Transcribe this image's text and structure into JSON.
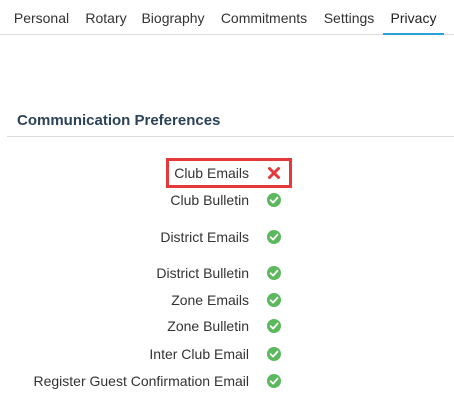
{
  "tabs": [
    {
      "label": "Personal",
      "active": false
    },
    {
      "label": "Rotary",
      "active": false
    },
    {
      "label": "Biography",
      "active": false
    },
    {
      "label": "Commitments",
      "active": false
    },
    {
      "label": "Settings",
      "active": false
    },
    {
      "label": "Privacy",
      "active": true
    }
  ],
  "section": {
    "title": "Communication Preferences"
  },
  "preferences": [
    {
      "label": "Club Emails",
      "status": "disabled",
      "icon": "x-icon"
    },
    {
      "label": "Club Bulletin",
      "status": "enabled",
      "icon": "check-icon"
    },
    {
      "label": "District Emails",
      "status": "enabled",
      "icon": "check-icon"
    },
    {
      "label": "District Bulletin",
      "status": "enabled",
      "icon": "check-icon"
    },
    {
      "label": "Zone Emails",
      "status": "enabled",
      "icon": "check-icon"
    },
    {
      "label": "Zone Bulletin",
      "status": "enabled",
      "icon": "check-icon"
    },
    {
      "label": "Inter Club Email",
      "status": "enabled",
      "icon": "check-icon"
    },
    {
      "label": "Register Guest Confirmation Email",
      "status": "enabled",
      "icon": "check-icon"
    }
  ],
  "colors": {
    "accent": "#2aa0d6",
    "enabled": "#5cb85c",
    "disabled": "#e5383b",
    "highlight": "#e5383b"
  }
}
